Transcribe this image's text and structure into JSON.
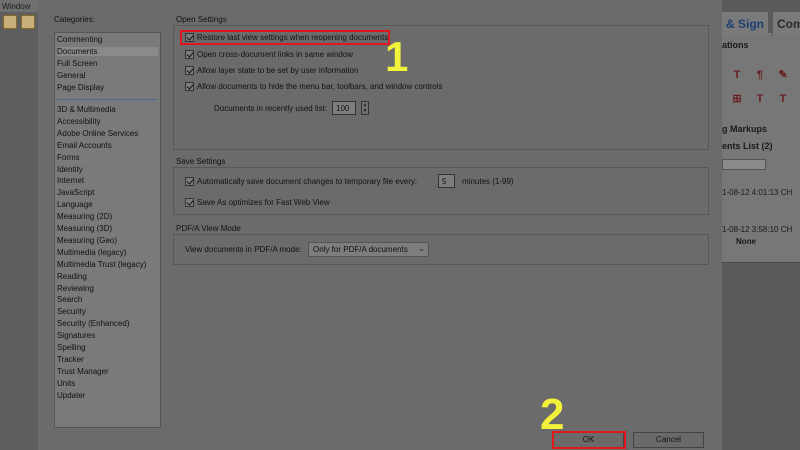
{
  "app": {
    "menu_window": "Window",
    "tab_sign": "& Sign",
    "tab_comment": "Comm",
    "panel_rows": {
      "annotations": "ations",
      "markups": "g Markups",
      "list": "ents List (2)",
      "ts1": "1-08-12 4:01:13 CH",
      "ts2": "1-08-12 3:58:10 CH",
      "none": "None"
    },
    "tool_glyphs": [
      "T",
      "¶",
      "✎",
      "⊞",
      "T",
      "T",
      "±",
      "Ṯ",
      "Ŧ"
    ]
  },
  "dialog": {
    "categories_label": "Categories:",
    "categories_top": [
      "Commenting",
      "Documents",
      "Full Screen",
      "General",
      "Page Display"
    ],
    "categories_rest": [
      "3D & Multimedia",
      "Accessibility",
      "Adobe Online Services",
      "Email Accounts",
      "Forms",
      "Identity",
      "Internet",
      "JavaScript",
      "Language",
      "Measuring (2D)",
      "Measuring (3D)",
      "Measuring (Geo)",
      "Multimedia (legacy)",
      "Multimedia Trust (legacy)",
      "Reading",
      "Reviewing",
      "Search",
      "Security",
      "Security (Enhanced)",
      "Signatures",
      "Spelling",
      "Tracker",
      "Trust Manager",
      "Units",
      "Updater"
    ],
    "selected_category": "Documents",
    "open_settings": {
      "title": "Open Settings",
      "restore_view": "Restore last view settings when reopening documents",
      "cross_doc_links": "Open cross-document links in same window",
      "layer_state": "Allow layer state to be set by user information",
      "hide_bars": "Allow documents to hide the menu bar, toolbars, and window controls",
      "recent_list_label": "Documents in recently used list:",
      "recent_list_value": "100"
    },
    "save_settings": {
      "title": "Save Settings",
      "autosave": "Automatically save document changes to temporary file every:",
      "autosave_value": "5",
      "autosave_unit": "minutes (1-99)",
      "fast_web": "Save As optimizes for Fast Web View"
    },
    "pdfa": {
      "title": "PDF/A View Mode",
      "label": "View documents in PDF/A mode:",
      "value": "Only for PDF/A documents"
    },
    "ok_label": "OK",
    "cancel_label": "Cancel"
  },
  "annotations": {
    "step1": "1",
    "step2": "2",
    "highlight_color": "#e0181e",
    "number_color": "#f2f23a"
  }
}
